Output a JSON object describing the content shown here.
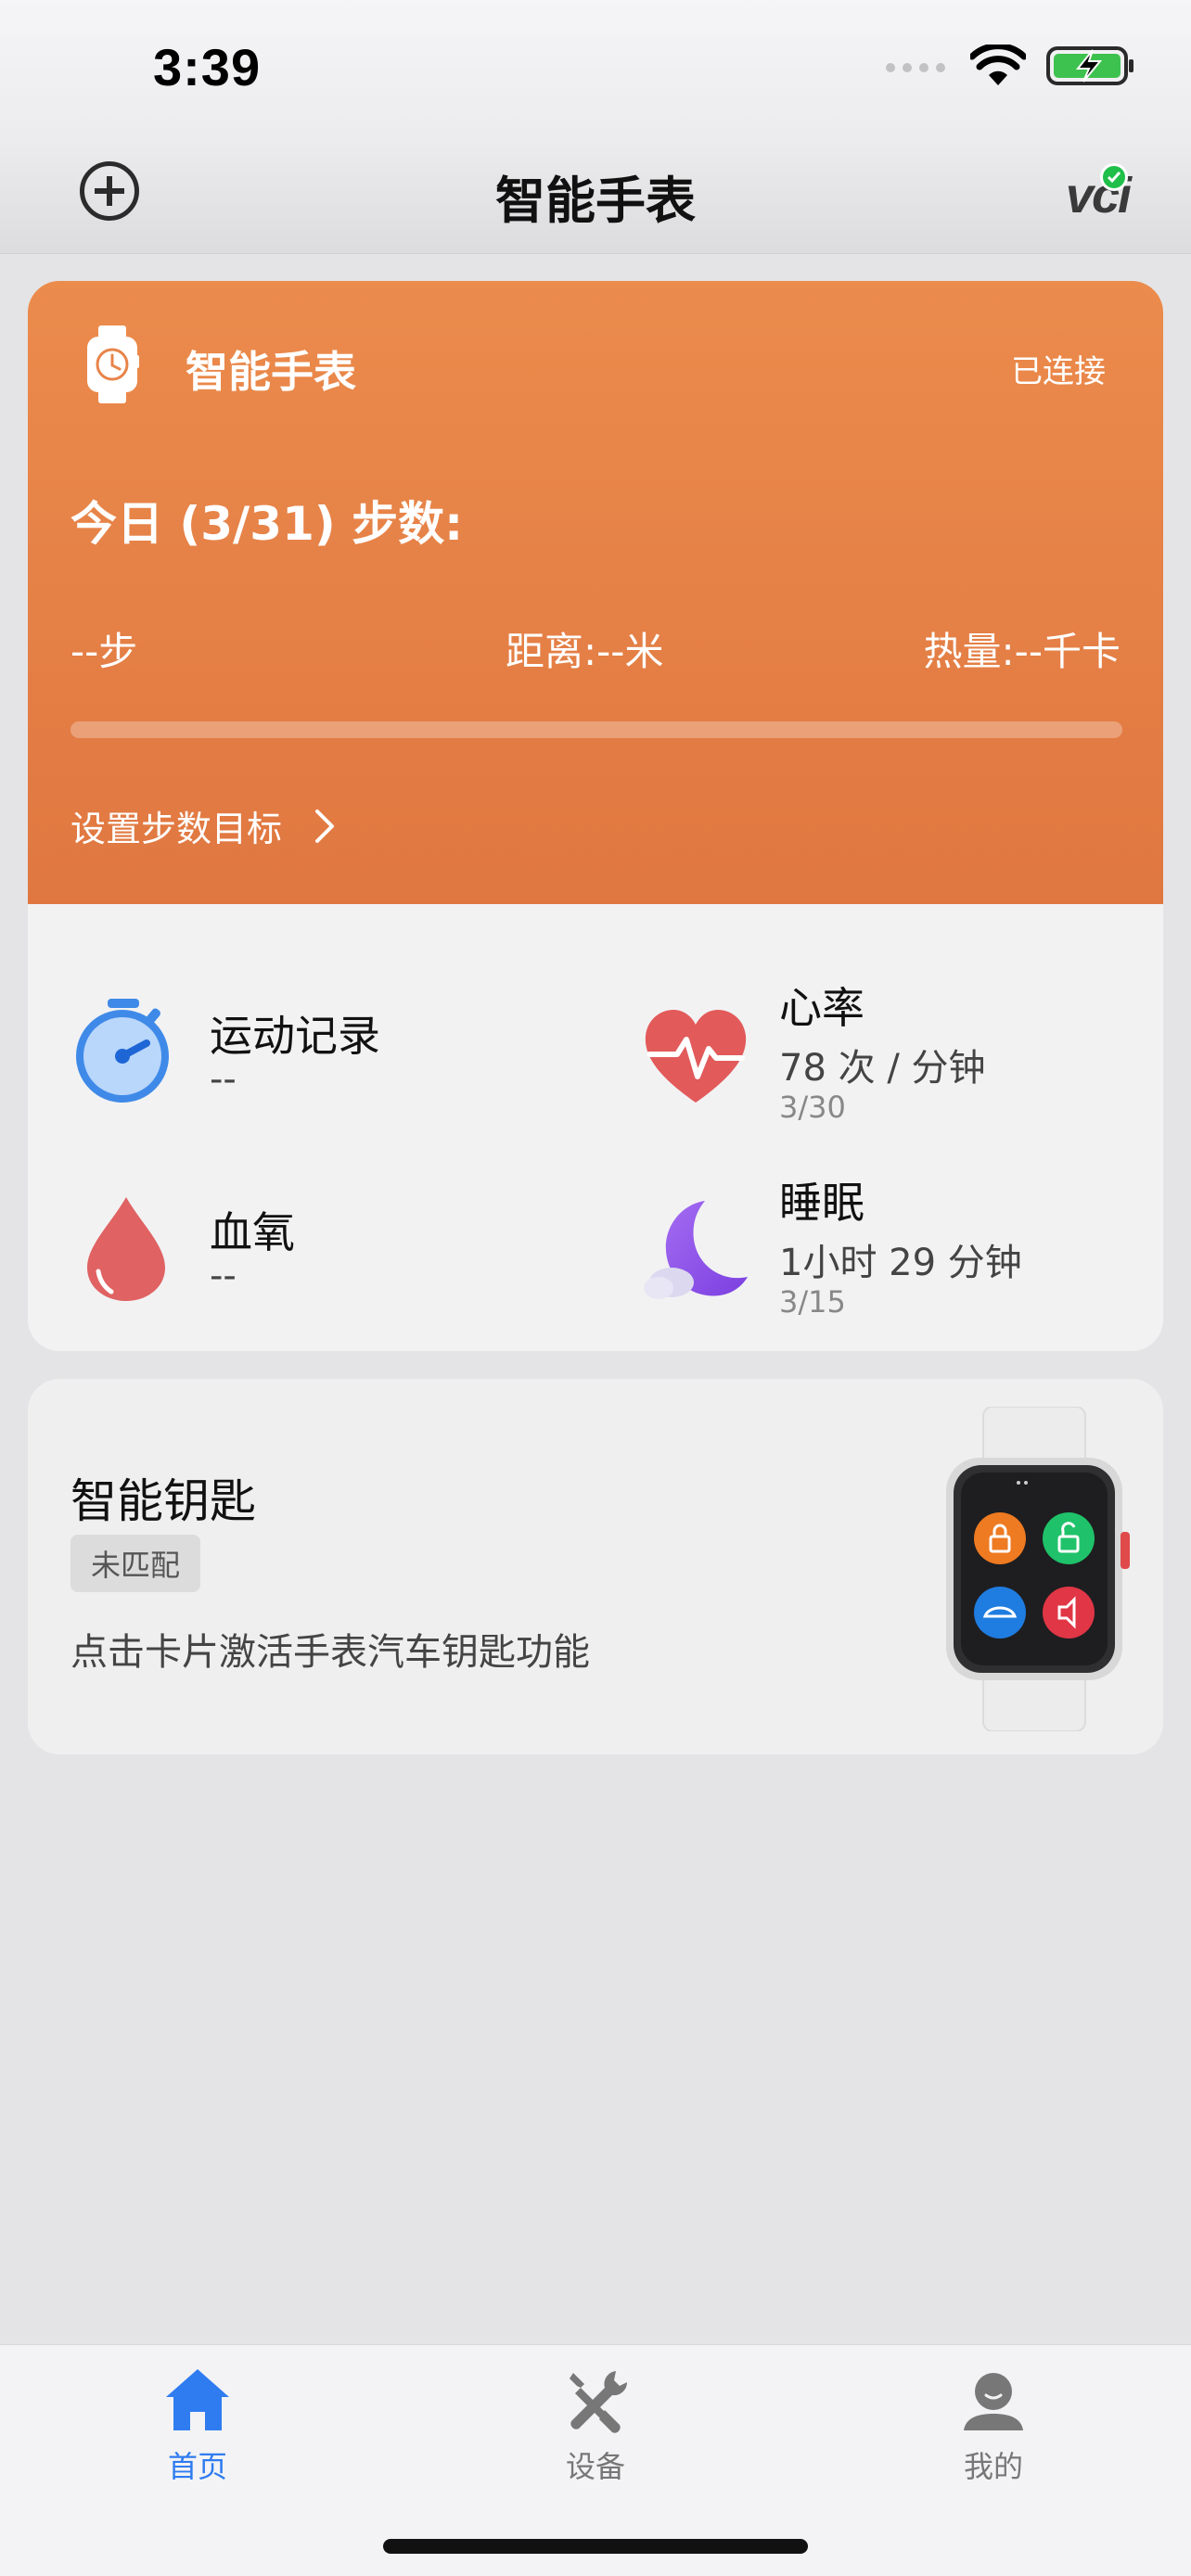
{
  "status_bar": {
    "time": "3:39"
  },
  "nav": {
    "title": "智能手表",
    "logo": "vci"
  },
  "device": {
    "name": "智能手表",
    "status": "已连接",
    "steps_title": "今日 (3/31) 步数:",
    "steps": "--步",
    "distance": "距离:--米",
    "calories": "热量:--千卡",
    "progress": 0,
    "goal_label": "设置步数目标"
  },
  "tiles": {
    "exercise": {
      "title": "运动记录",
      "value": "--"
    },
    "heart_rate": {
      "title": "心率",
      "value": "78 次 / 分钟",
      "date": "3/30"
    },
    "blood_oxygen": {
      "title": "血氧",
      "value": "--"
    },
    "sleep": {
      "title": "睡眠",
      "value": "1小时 29 分钟",
      "date": "3/15"
    }
  },
  "smart_key": {
    "title": "智能钥匙",
    "badge": "未匹配",
    "description": "点击卡片激活手表汽车钥匙功能"
  },
  "tabs": [
    {
      "label": "首页",
      "icon": "home-icon",
      "active": true
    },
    {
      "label": "设备",
      "icon": "tools-icon",
      "active": false
    },
    {
      "label": "我的",
      "icon": "profile-icon",
      "active": false
    }
  ],
  "colors": {
    "accent": "#2f7cf0",
    "card_orange": "#e8844a",
    "inactive_tab": "#777777",
    "connected_green": "#1fbf4a"
  }
}
